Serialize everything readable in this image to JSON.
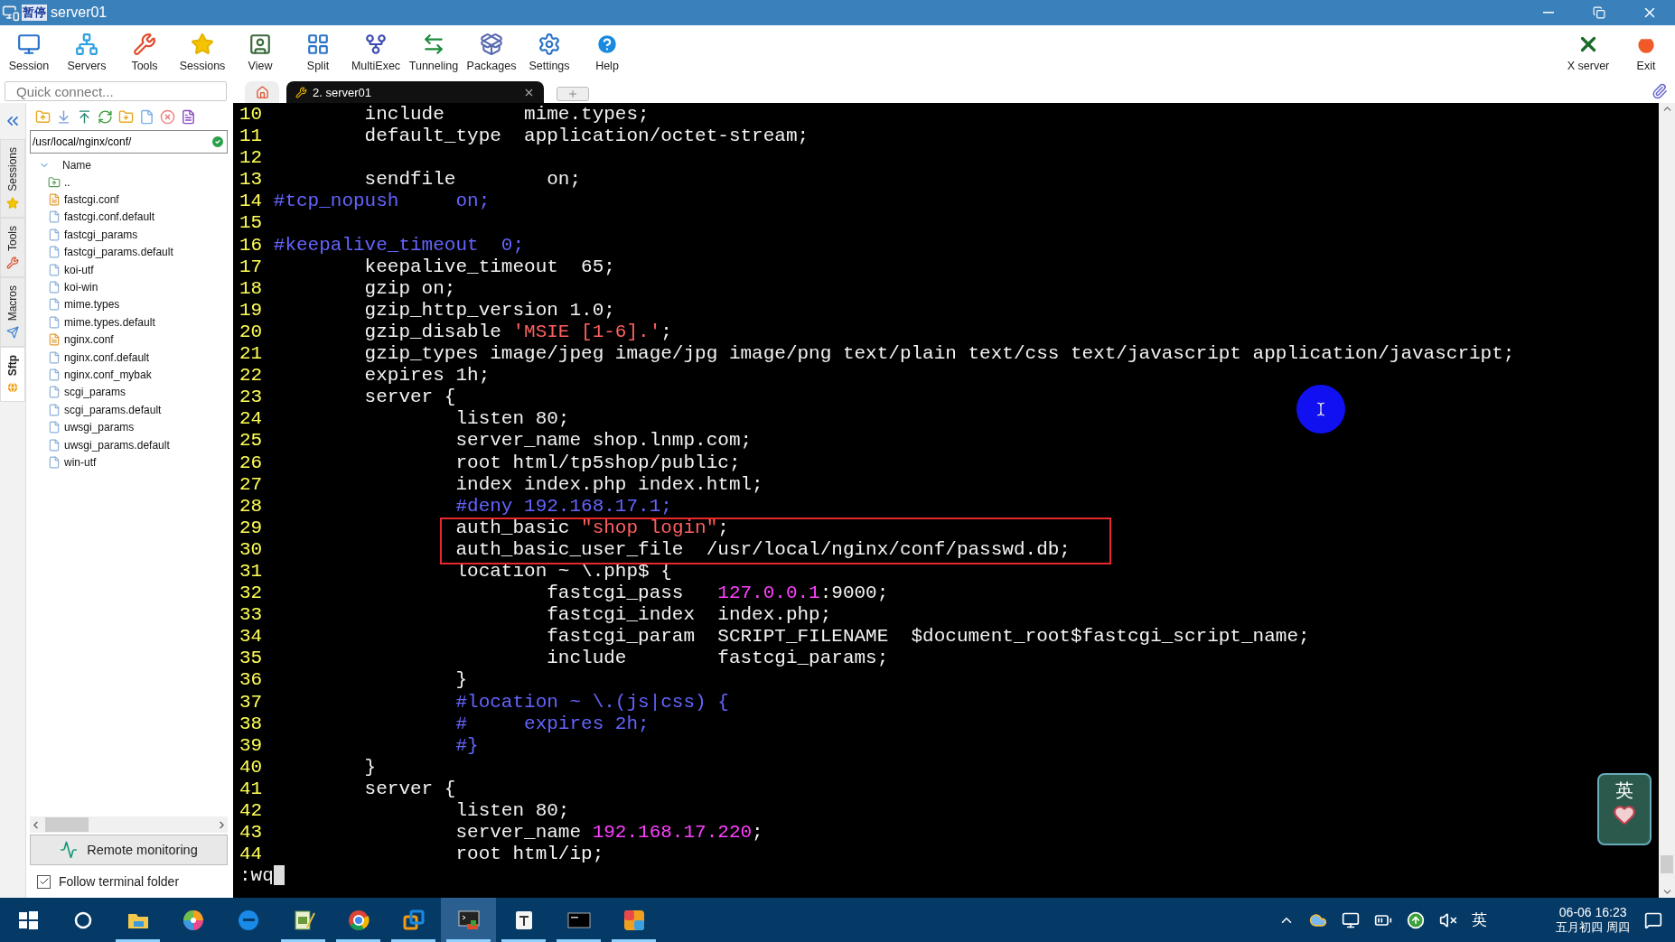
{
  "window": {
    "title": "server01",
    "overlay_label": "暂停"
  },
  "toolbar": [
    {
      "label": "Session",
      "kind": "session"
    },
    {
      "label": "Servers",
      "kind": "servers"
    },
    {
      "label": "Tools",
      "kind": "tools"
    },
    {
      "label": "Sessions",
      "kind": "sessions"
    },
    {
      "label": "View",
      "kind": "view"
    },
    {
      "label": "Split",
      "kind": "split"
    },
    {
      "label": "MultiExec",
      "kind": "multiexec"
    },
    {
      "label": "Tunneling",
      "kind": "tunneling"
    },
    {
      "label": "Packages",
      "kind": "packages"
    },
    {
      "label": "Settings",
      "kind": "settings"
    },
    {
      "label": "Help",
      "kind": "help"
    }
  ],
  "toolbar_right": [
    {
      "label": "X server",
      "kind": "xserver"
    },
    {
      "label": "Exit",
      "kind": "exit"
    }
  ],
  "quick_connect": {
    "placeholder": "Quick connect..."
  },
  "tabs": [
    {
      "label": "2. server01",
      "selected": true
    }
  ],
  "side_tabs": [
    {
      "label": "Sessions",
      "kind": "star",
      "selected": false
    },
    {
      "label": "Tools",
      "kind": "tools",
      "selected": false
    },
    {
      "label": "Macros",
      "kind": "plane",
      "selected": false
    },
    {
      "label": "Sftp",
      "kind": "globe",
      "selected": true
    }
  ],
  "sftp": {
    "path": "/usr/local/nginx/conf/",
    "column": "Name",
    "files": [
      {
        "name": "..",
        "kind": "parent"
      },
      {
        "name": "fastcgi.conf",
        "kind": "edited"
      },
      {
        "name": "fastcgi.conf.default",
        "kind": "file"
      },
      {
        "name": "fastcgi_params",
        "kind": "file"
      },
      {
        "name": "fastcgi_params.default",
        "kind": "file"
      },
      {
        "name": "koi-utf",
        "kind": "file"
      },
      {
        "name": "koi-win",
        "kind": "file"
      },
      {
        "name": "mime.types",
        "kind": "file"
      },
      {
        "name": "mime.types.default",
        "kind": "file"
      },
      {
        "name": "nginx.conf",
        "kind": "edited"
      },
      {
        "name": "nginx.conf.default",
        "kind": "file"
      },
      {
        "name": "nginx.conf_mybak",
        "kind": "file"
      },
      {
        "name": "scgi_params",
        "kind": "file"
      },
      {
        "name": "scgi_params.default",
        "kind": "file"
      },
      {
        "name": "uwsgi_params",
        "kind": "file"
      },
      {
        "name": "uwsgi_params.default",
        "kind": "file"
      },
      {
        "name": "win-utf",
        "kind": "file"
      }
    ],
    "remote_monitoring": "Remote monitoring",
    "follow_terminal_folder": {
      "label": "Follow terminal folder",
      "checked": true
    }
  },
  "terminal": {
    "lines": [
      {
        "number": "10",
        "boxed": false,
        "segments": [
          {
            "text": "        include       mime.types;",
            "kind": "plain"
          }
        ]
      },
      {
        "number": "11",
        "boxed": false,
        "segments": [
          {
            "text": "        default_type  application/octet-stream;",
            "kind": "plain"
          }
        ]
      },
      {
        "number": "12",
        "boxed": false
      },
      {
        "number": "13",
        "boxed": false,
        "segments": [
          {
            "text": "        sendfile        on;",
            "kind": "plain"
          }
        ]
      },
      {
        "number": "14",
        "boxed": false,
        "segments": [
          {
            "text": "#tcp_nopush     on;",
            "kind": "comment"
          }
        ]
      },
      {
        "number": "15",
        "boxed": false
      },
      {
        "number": "16",
        "boxed": false,
        "segments": [
          {
            "text": "#keepalive_timeout  0;",
            "kind": "comment"
          }
        ]
      },
      {
        "number": "17",
        "boxed": false,
        "segments": [
          {
            "text": "        keepalive_timeout  65;",
            "kind": "plain"
          }
        ]
      },
      {
        "number": "18",
        "boxed": false,
        "segments": [
          {
            "text": "        gzip on;",
            "kind": "plain"
          }
        ]
      },
      {
        "number": "19",
        "boxed": false,
        "segments": [
          {
            "text": "        gzip_http_version 1.0;",
            "kind": "plain"
          }
        ]
      },
      {
        "number": "20",
        "boxed": false,
        "segments": [
          {
            "text": "        gzip_disable ",
            "kind": "plain"
          },
          {
            "text": "'MSIE [1-6].'",
            "kind": "string"
          },
          {
            "text": ";",
            "kind": "plain"
          }
        ]
      },
      {
        "number": "21",
        "boxed": false,
        "segments": [
          {
            "text": "        gzip_types image/jpeg image/jpg image/png text/plain text/css text/javascript application/javascript;",
            "kind": "plain"
          }
        ]
      },
      {
        "number": "22",
        "boxed": false,
        "segments": [
          {
            "text": "        expires 1h;",
            "kind": "plain"
          }
        ]
      },
      {
        "number": "23",
        "boxed": false,
        "segments": [
          {
            "text": "        server {",
            "kind": "plain"
          }
        ]
      },
      {
        "number": "24",
        "boxed": false,
        "segments": [
          {
            "text": "                listen 80;",
            "kind": "plain"
          }
        ]
      },
      {
        "number": "25",
        "boxed": false,
        "segments": [
          {
            "text": "                server_name shop.lnmp.com;",
            "kind": "plain"
          }
        ]
      },
      {
        "number": "26",
        "boxed": false,
        "segments": [
          {
            "text": "                root html/tp5shop/public;",
            "kind": "plain"
          }
        ]
      },
      {
        "number": "27",
        "boxed": false,
        "segments": [
          {
            "text": "                index index.php index.html;",
            "kind": "plain"
          }
        ]
      },
      {
        "number": "28",
        "boxed": false,
        "segments": [
          {
            "text": "                #deny 192.168.17.1;",
            "kind": "comment"
          }
        ]
      },
      {
        "number": "29",
        "boxed": true,
        "segments": [
          {
            "text": "                auth_basic ",
            "kind": "plain"
          },
          {
            "text": "\"shop login\"",
            "kind": "string"
          },
          {
            "text": ";",
            "kind": "plain"
          }
        ]
      },
      {
        "number": "30",
        "boxed": true,
        "segments": [
          {
            "text": "                auth_basic_user_file  /usr/local/nginx/conf/passwd.db;",
            "kind": "plain"
          }
        ]
      },
      {
        "number": "31",
        "boxed": false,
        "segments": [
          {
            "text": "                location ~ \\.php$ {",
            "kind": "plain"
          }
        ]
      },
      {
        "number": "32",
        "boxed": false,
        "segments": [
          {
            "text": "                        fastcgi_pass   ",
            "kind": "plain"
          },
          {
            "text": "127.0.0.1",
            "kind": "number"
          },
          {
            "text": ":9000;",
            "kind": "plain"
          }
        ]
      },
      {
        "number": "33",
        "boxed": false,
        "segments": [
          {
            "text": "                        fastcgi_index  index.php;",
            "kind": "plain"
          }
        ]
      },
      {
        "number": "34",
        "boxed": false,
        "segments": [
          {
            "text": "                        fastcgi_param  SCRIPT_FILENAME  $document_root$fastcgi_script_name;",
            "kind": "plain"
          }
        ]
      },
      {
        "number": "35",
        "boxed": false,
        "segments": [
          {
            "text": "                        include        fastcgi_params;",
            "kind": "plain"
          }
        ]
      },
      {
        "number": "36",
        "boxed": false,
        "segments": [
          {
            "text": "                }",
            "kind": "plain"
          }
        ]
      },
      {
        "number": "37",
        "boxed": false,
        "segments": [
          {
            "text": "                #location ~ \\.(js|css) {",
            "kind": "comment"
          }
        ]
      },
      {
        "number": "38",
        "boxed": false,
        "segments": [
          {
            "text": "                #     expires 2h;",
            "kind": "comment"
          }
        ]
      },
      {
        "number": "39",
        "boxed": false,
        "segments": [
          {
            "text": "                #}",
            "kind": "comment"
          }
        ]
      },
      {
        "number": "40",
        "boxed": false,
        "segments": [
          {
            "text": "        }",
            "kind": "plain"
          }
        ]
      },
      {
        "number": "41",
        "boxed": false,
        "segments": [
          {
            "text": "        server {",
            "kind": "plain"
          }
        ]
      },
      {
        "number": "42",
        "boxed": false,
        "segments": [
          {
            "text": "                listen 80;",
            "kind": "plain"
          }
        ]
      },
      {
        "number": "43",
        "boxed": false,
        "segments": [
          {
            "text": "                server_name ",
            "kind": "plain"
          },
          {
            "text": "192.168.17.220",
            "kind": "number"
          },
          {
            "text": ";",
            "kind": "plain"
          }
        ]
      },
      {
        "number": "44",
        "boxed": false,
        "segments": [
          {
            "text": "                root html/ip;",
            "kind": "plain"
          }
        ]
      }
    ],
    "command": ":wq"
  },
  "ime_widget": {
    "label": "英"
  },
  "taskbar": {
    "apps": [
      {
        "kind": "start",
        "selected": false,
        "running": false
      },
      {
        "kind": "search",
        "selected": false,
        "running": false
      },
      {
        "kind": "explorer",
        "selected": false,
        "running": true
      },
      {
        "kind": "photos",
        "selected": false,
        "running": false
      },
      {
        "kind": "edge",
        "selected": false,
        "running": false
      },
      {
        "kind": "notepad",
        "selected": false,
        "running": true
      },
      {
        "kind": "chrome",
        "selected": false,
        "running": true
      },
      {
        "kind": "vm",
        "selected": false,
        "running": true
      },
      {
        "kind": "terminal-app",
        "selected": true,
        "running": true
      },
      {
        "kind": "editor",
        "selected": false,
        "running": true
      },
      {
        "kind": "console",
        "selected": false,
        "running": true
      },
      {
        "kind": "pdf",
        "selected": false,
        "running": true
      }
    ],
    "ime": "英",
    "time": "06-06 16:23",
    "date": "五月初四 周四"
  }
}
